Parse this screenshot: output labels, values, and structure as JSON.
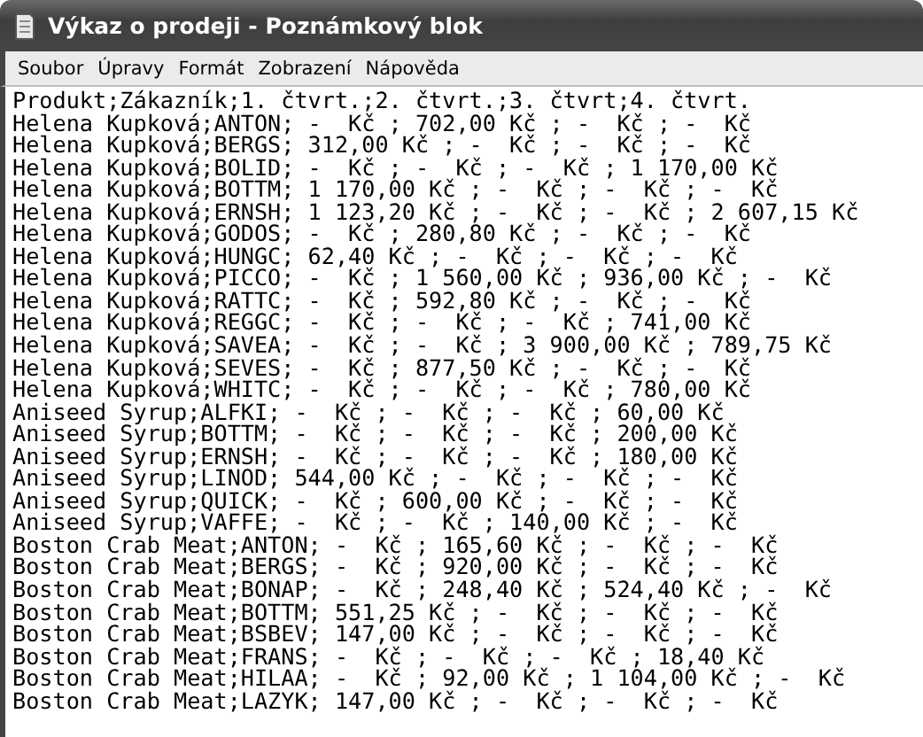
{
  "window": {
    "title": "Výkaz o prodeji - Poznámkový blok"
  },
  "menu": [
    "Soubor",
    "Úpravy",
    "Formát",
    "Zobrazení",
    "Nápověda"
  ],
  "lines": [
    "Produkt;Zákazník;1. čtvrt.;2. čtvrt.;3. čtvrt;4. čtvrt.",
    "Helena Kupková;ANTON; -  Kč ; 702,00 Kč ; -  Kč ; -  Kč",
    "Helena Kupková;BERGS; 312,00 Kč ; -  Kč ; -  Kč ; -  Kč",
    "Helena Kupková;BOLID; -  Kč ; -  Kč ; -  Kč ; 1 170,00 Kč",
    "Helena Kupková;BOTTM; 1 170,00 Kč ; -  Kč ; -  Kč ; -  Kč",
    "Helena Kupková;ERNSH; 1 123,20 Kč ; -  Kč ; -  Kč ; 2 607,15 Kč",
    "Helena Kupková;GODOS; -  Kč ; 280,80 Kč ; -  Kč ; -  Kč",
    "Helena Kupková;HUNGC; 62,40 Kč ; -  Kč ; -  Kč ; -  Kč",
    "Helena Kupková;PICCO; -  Kč ; 1 560,00 Kč ; 936,00 Kč ; -  Kč",
    "Helena Kupková;RATTC; -  Kč ; 592,80 Kč ; -  Kč ; -  Kč",
    "Helena Kupková;REGGC; -  Kč ; -  Kč ; -  Kč ; 741,00 Kč",
    "Helena Kupková;SAVEA; -  Kč ; -  Kč ; 3 900,00 Kč ; 789,75 Kč",
    "Helena Kupková;SEVES; -  Kč ; 877,50 Kč ; -  Kč ; -  Kč",
    "Helena Kupková;WHITC; -  Kč ; -  Kč ; -  Kč ; 780,00 Kč",
    "Aniseed Syrup;ALFKI; -  Kč ; -  Kč ; -  Kč ; 60,00 Kč",
    "Aniseed Syrup;BOTTM; -  Kč ; -  Kč ; -  Kč ; 200,00 Kč",
    "Aniseed Syrup;ERNSH; -  Kč ; -  Kč ; -  Kč ; 180,00 Kč",
    "Aniseed Syrup;LINOD; 544,00 Kč ; -  Kč ; -  Kč ; -  Kč",
    "Aniseed Syrup;QUICK; -  Kč ; 600,00 Kč ; -  Kč ; -  Kč",
    "Aniseed Syrup;VAFFE; -  Kč ; -  Kč ; 140,00 Kč ; -  Kč",
    "Boston Crab Meat;ANTON; -  Kč ; 165,60 Kč ; -  Kč ; -  Kč",
    "Boston Crab Meat;BERGS; -  Kč ; 920,00 Kč ; -  Kč ; -  Kč",
    "Boston Crab Meat;BONAP; -  Kč ; 248,40 Kč ; 524,40 Kč ; -  Kč",
    "Boston Crab Meat;BOTTM; 551,25 Kč ; -  Kč ; -  Kč ; -  Kč",
    "Boston Crab Meat;BSBEV; 147,00 Kč ; -  Kč ; -  Kč ; -  Kč",
    "Boston Crab Meat;FRANS; -  Kč ; -  Kč ; -  Kč ; 18,40 Kč",
    "Boston Crab Meat;HILAA; -  Kč ; 92,00 Kč ; 1 104,00 Kč ; -  Kč",
    "Boston Crab Meat;LAZYK; 147,00 Kč ; -  Kč ; -  Kč ; -  Kč"
  ]
}
